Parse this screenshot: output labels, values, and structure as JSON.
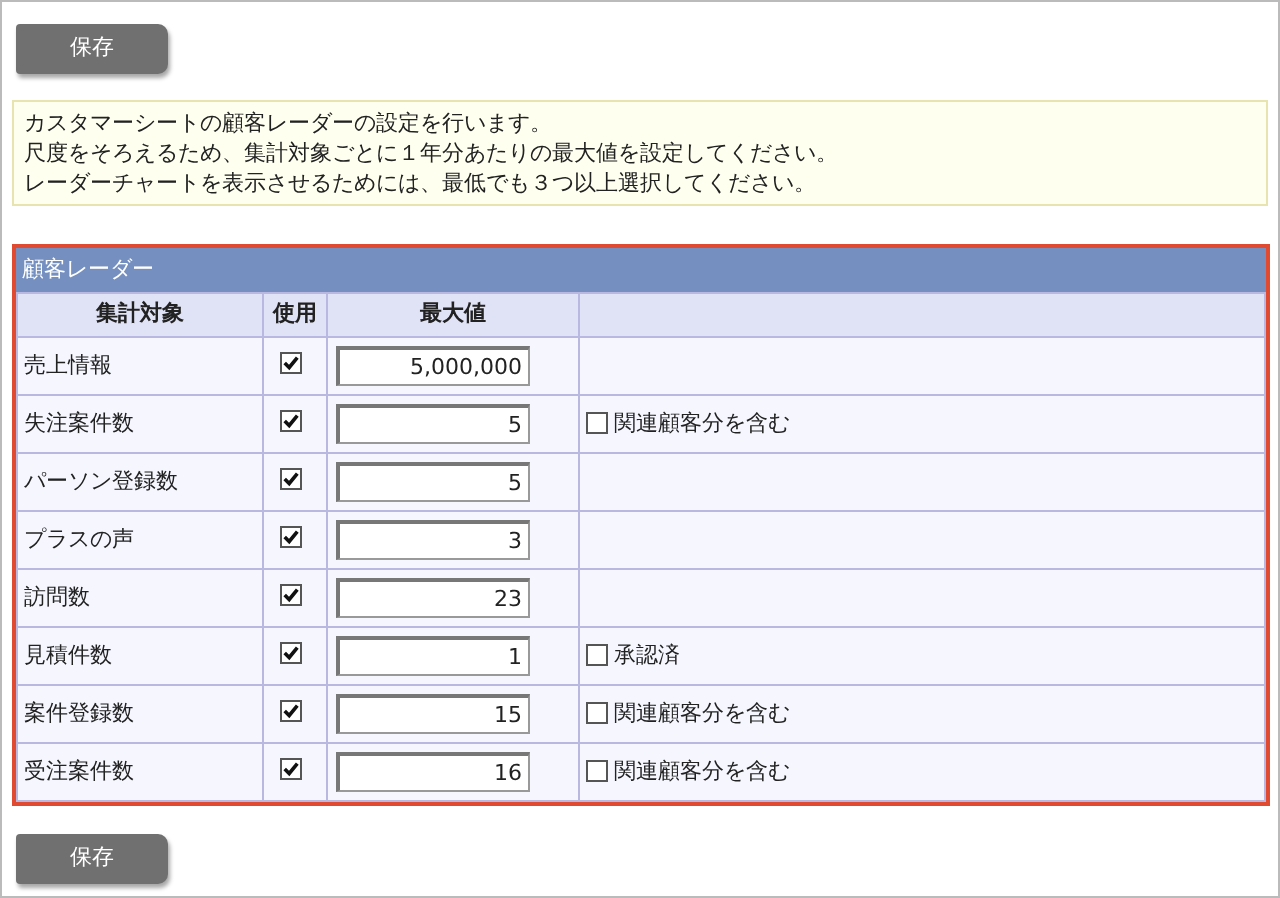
{
  "save_button_top": {
    "label": "保存"
  },
  "notice": {
    "lines": [
      "カスタマーシートの顧客レーダーの設定を行います。",
      "尺度をそろえるため、集計対象ごとに１年分あたりの最大値を設定してください。",
      "レーダーチャートを表示させるためには、最低でも３つ以上選択してください。"
    ]
  },
  "panel": {
    "title": "顧客レーダー",
    "columns": [
      "集計対象",
      "使用",
      "最大値"
    ],
    "rows": [
      {
        "name": "売上情報",
        "used": true,
        "max": "5,000,000"
      },
      {
        "name": "失注案件数",
        "used": true,
        "max": "5",
        "option": {
          "label": "関連顧客分を含む",
          "checked": false
        }
      },
      {
        "name": "パーソン登録数",
        "used": true,
        "max": "5"
      },
      {
        "name": "プラスの声",
        "used": true,
        "max": "3"
      },
      {
        "name": "訪問数",
        "used": true,
        "max": "23"
      },
      {
        "name": "見積件数",
        "used": true,
        "max": "1",
        "option": {
          "label": "承認済",
          "checked": false
        }
      },
      {
        "name": "案件登録数",
        "used": true,
        "max": "15",
        "option": {
          "label": "関連顧客分を含む",
          "checked": false
        }
      },
      {
        "name": "受注案件数",
        "used": true,
        "max": "16",
        "option": {
          "label": "関連顧客分を含む",
          "checked": false
        }
      }
    ]
  },
  "save_button_bottom": {
    "label": "保存"
  }
}
